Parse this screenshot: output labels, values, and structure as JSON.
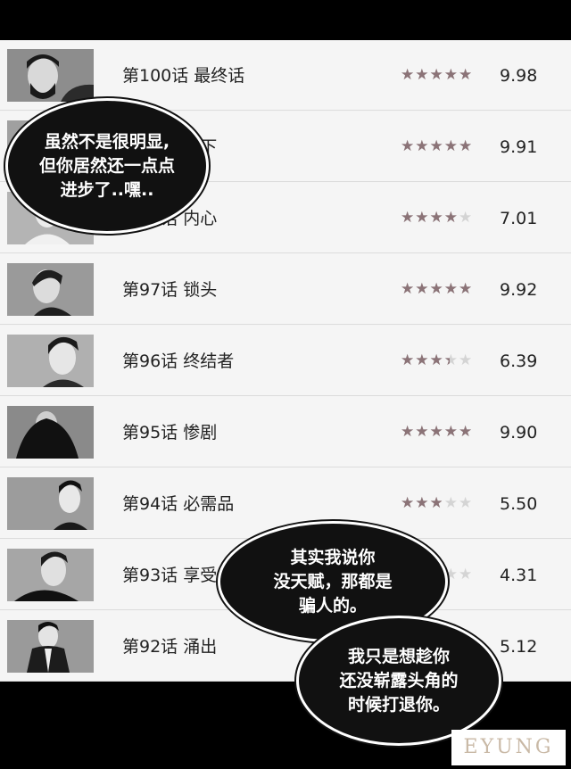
{
  "episodes": [
    {
      "title": "第100话 最终话",
      "rating_fraction": 0.9,
      "score": "9.98"
    },
    {
      "title": "第99话 在下",
      "rating_fraction": 0.9,
      "score": "9.91"
    },
    {
      "title": "第98话 内心",
      "rating_fraction": 0.7,
      "score": "7.01"
    },
    {
      "title": "第97话 锁头",
      "rating_fraction": 1.0,
      "score": "9.92"
    },
    {
      "title": "第96话 终结者",
      "rating_fraction": 0.6,
      "score": "6.39"
    },
    {
      "title": "第95话 惨剧",
      "rating_fraction": 1.0,
      "score": "9.90"
    },
    {
      "title": "第94话 必需品",
      "rating_fraction": 0.5,
      "score": "5.50"
    },
    {
      "title": "第93话 享受",
      "rating_fraction": 0.4,
      "score": "4.31"
    },
    {
      "title": "第92话 涌出",
      "rating_fraction": 0.5,
      "score": "5.12"
    }
  ],
  "speech_bubbles": {
    "left": [
      "虽然不是很明显,",
      "但你居然还一点点",
      "进步了..嘿.."
    ],
    "middle": [
      "其实我说你",
      "没天赋，那都是",
      "骗人的。"
    ],
    "bottom": [
      "我只是想趁你",
      "还没崭露头角的",
      "时候打退你。"
    ]
  },
  "watermark": "EYUNG",
  "colors": {
    "star_fill": "#8b7377",
    "star_empty": "#d4d4d4",
    "row_bg": "#f5f5f5",
    "frame": "#000000"
  }
}
